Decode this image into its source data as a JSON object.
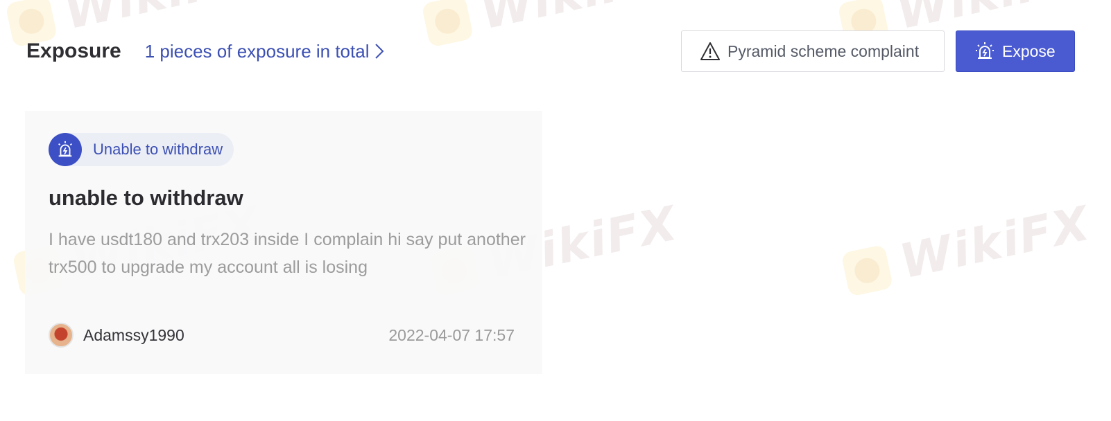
{
  "watermark": {
    "text": "WikiFX"
  },
  "header": {
    "title": "Exposure",
    "total_link": "1 pieces of exposure in total",
    "complaint_button": "Pyramid scheme complaint",
    "expose_button": "Expose"
  },
  "card": {
    "tag": "Unable to withdraw",
    "title": "unable to withdraw",
    "body": "I have usdt180 and trx203 inside I complain hi say put another trx500 to upgrade my account all is losing",
    "username": "Adamssy1990",
    "timestamp": "2022-04-07 17:57"
  },
  "colors": {
    "accent": "#4a5bd2",
    "link": "#3c50b4",
    "title": "#2f2f33",
    "muted": "#9c9c9c"
  },
  "icons": {
    "complaint": "warning-triangle-icon",
    "expose": "alarm-siren-icon",
    "chevron": "chevron-right-icon"
  }
}
